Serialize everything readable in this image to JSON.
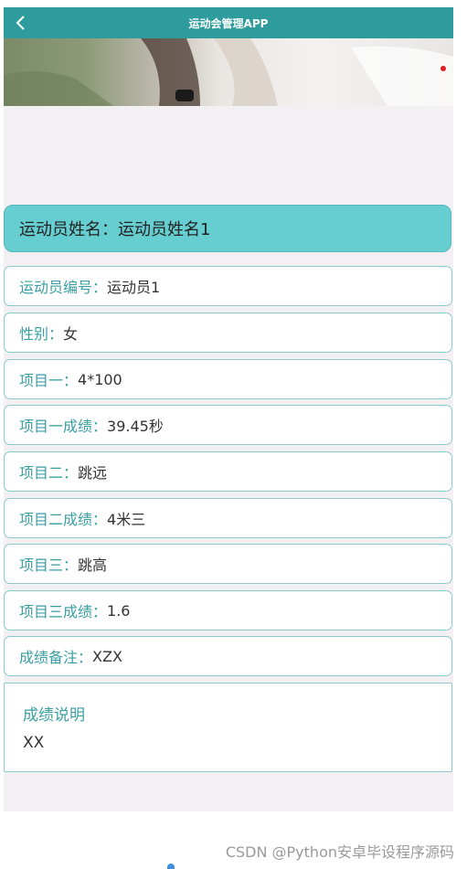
{
  "header": {
    "title": "运动会管理APP",
    "back_icon": "chevron-left-icon"
  },
  "athlete": {
    "name_label": "运动员姓名：",
    "name_value": "运动员姓名1"
  },
  "fields": [
    {
      "label": "运动员编号：",
      "value": "运动员1"
    },
    {
      "label": "性别：",
      "value": "女"
    },
    {
      "label": "项目一：",
      "value": "4*100"
    },
    {
      "label": "项目一成绩：",
      "value": "39.45秒"
    },
    {
      "label": "项目二：",
      "value": "跳远"
    },
    {
      "label": "项目二成绩：",
      "value": "4米三"
    },
    {
      "label": "项目三：",
      "value": "跳高"
    },
    {
      "label": "项目三成绩：",
      "value": "1.6"
    },
    {
      "label": "成绩备注：",
      "value": "XZX"
    }
  ],
  "description": {
    "label": "成绩说明",
    "value": "XX"
  },
  "watermark": "CSDN @Python安卓毕设程序源码",
  "colors": {
    "header_bg": "#2e9c9c",
    "name_card_bg": "#66cdd0",
    "label_color": "#3a9fa2",
    "page_bg": "#f2f0f3"
  }
}
